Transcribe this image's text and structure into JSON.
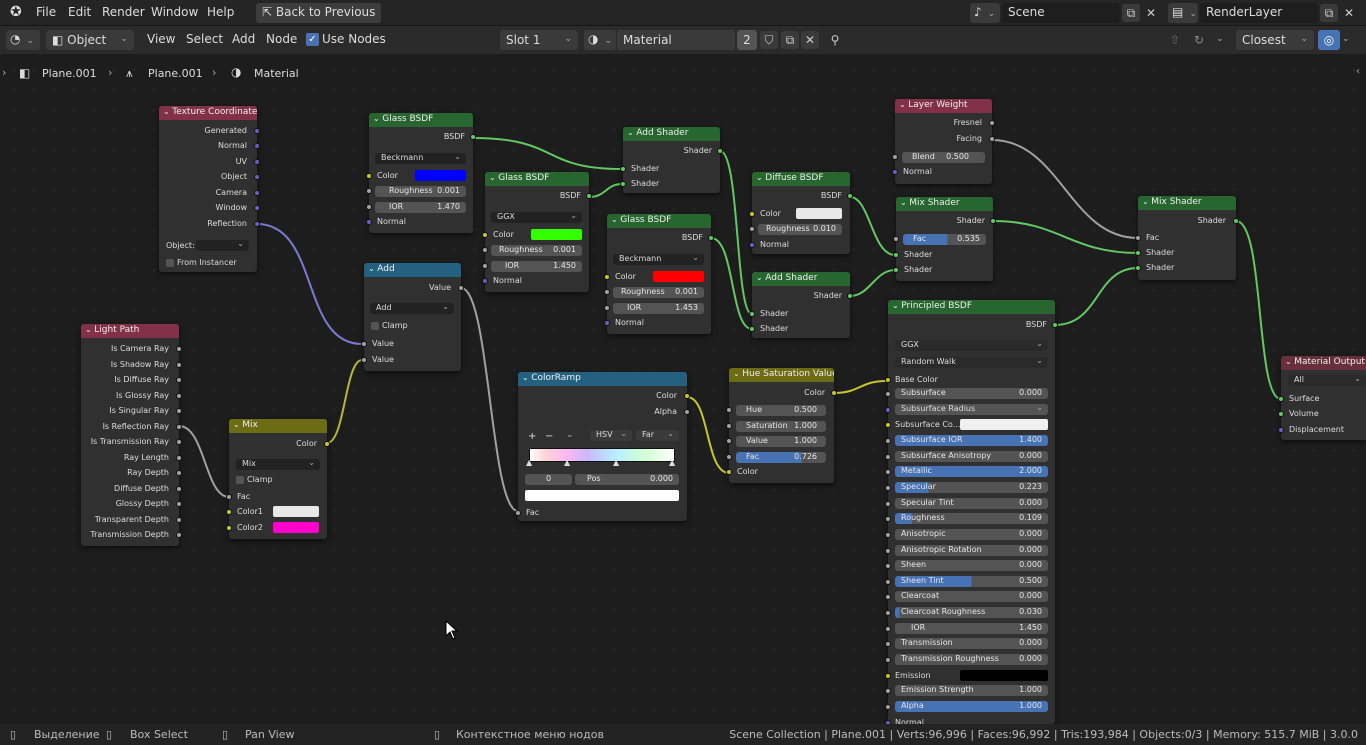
{
  "menu": {
    "file": "File",
    "edit": "Edit",
    "render": "Render",
    "window": "Window",
    "help": "Help",
    "back": "Back to Previous"
  },
  "scene": {
    "name": "Scene",
    "layer": "RenderLayer"
  },
  "header": {
    "mode": "Object",
    "view": "View",
    "select": "Select",
    "add": "Add",
    "node": "Node",
    "use_nodes": "Use Nodes",
    "slot": "Slot 1",
    "material": "Material",
    "users": "2",
    "snap": "Closest"
  },
  "breadcrumb": {
    "obj": "Plane.001",
    "mesh": "Plane.001",
    "mat": "Material"
  },
  "colors": {
    "accent": "#4772b3",
    "shader_header": "#27662f",
    "input_header": "#83314a",
    "converter_header": "#24607f",
    "color_header": "#6c6c14"
  },
  "nodes": {
    "texcoord": {
      "title": "Texture Coordinate",
      "outs": [
        "Generated",
        "Normal",
        "UV",
        "Object",
        "Camera",
        "Window",
        "Reflection"
      ],
      "object": "Object:",
      "from_instancer": "From Instancer"
    },
    "lightpath": {
      "title": "Light Path",
      "outs": [
        "Is Camera Ray",
        "Is Shadow Ray",
        "Is Diffuse Ray",
        "Is Glossy Ray",
        "Is Singular Ray",
        "Is Reflection Ray",
        "Is Transmission Ray",
        "Ray Length",
        "Ray Depth",
        "Diffuse Depth",
        "Glossy Depth",
        "Transparent Depth",
        "Transmission Depth"
      ]
    },
    "glass1": {
      "title": "Glass BSDF",
      "out": "BSDF",
      "dist": "Beckmann",
      "color": "Color",
      "rough_l": "Roughness",
      "rough": "0.001",
      "ior_l": "IOR",
      "ior": "1.470",
      "normal": "Normal"
    },
    "glass2": {
      "title": "Glass BSDF",
      "out": "BSDF",
      "dist": "GGX",
      "color": "Color",
      "rough_l": "Roughness",
      "rough": "0.001",
      "ior_l": "IOR",
      "ior": "1.450",
      "normal": "Normal"
    },
    "glass3": {
      "title": "Glass BSDF",
      "out": "BSDF",
      "dist": "Beckmann",
      "color": "Color",
      "rough_l": "Roughness",
      "rough": "0.001",
      "ior_l": "IOR",
      "ior": "1.453",
      "normal": "Normal"
    },
    "add": {
      "title": "Add",
      "out": "Value",
      "op": "Add",
      "clamp": "Clamp",
      "in1": "Value",
      "in2": "Value"
    },
    "mix": {
      "title": "Mix",
      "out": "Color",
      "blend": "Mix",
      "clamp": "Clamp",
      "fac": "Fac",
      "c1": "Color1",
      "c2": "Color2"
    },
    "addshader1": {
      "title": "Add Shader",
      "out": "Shader",
      "in1": "Shader",
      "in2": "Shader"
    },
    "addshader2": {
      "title": "Add Shader",
      "out": "Shader",
      "in1": "Shader",
      "in2": "Shader"
    },
    "diffuse": {
      "title": "Diffuse BSDF",
      "out": "BSDF",
      "color": "Color",
      "rough_l": "Roughness",
      "rough": "0.010",
      "normal": "Normal"
    },
    "layerweight": {
      "title": "Layer Weight",
      "fresnel": "Fresnel",
      "facing": "Facing",
      "blend_l": "Blend",
      "blend": "0.500",
      "normal": "Normal"
    },
    "mixshader1": {
      "title": "Mix Shader",
      "out": "Shader",
      "fac_l": "Fac",
      "fac": "0.535",
      "in1": "Shader",
      "in2": "Shader"
    },
    "mixshader2": {
      "title": "Mix Shader",
      "out": "Shader",
      "fac": "Fac",
      "in1": "Shader",
      "in2": "Shader"
    },
    "colorramp": {
      "title": "ColorRamp",
      "color": "Color",
      "alpha": "Alpha",
      "plus": "+",
      "minus": "−",
      "mode": "HSV",
      "interp": "Far",
      "index": "0",
      "pos_l": "Pos",
      "pos": "0.000",
      "fac": "Fac"
    },
    "hsv": {
      "title": "Hue Saturation Value",
      "out": "Color",
      "hue_l": "Hue",
      "hue": "0.500",
      "sat_l": "Saturation",
      "sat": "1.000",
      "val_l": "Value",
      "val": "1.000",
      "fac_l": "Fac",
      "fac": "0.726",
      "color": "Color"
    },
    "principled": {
      "title": "Principled BSDF",
      "out": "BSDF",
      "dist": "GGX",
      "sss": "Random Walk",
      "base": "Base Color",
      "fields": [
        [
          "Subsurface",
          "0.000"
        ],
        [
          "Subsurface Radius",
          ""
        ],
        [
          "Subsurface Co...",
          ""
        ],
        [
          "Subsurface IOR",
          "1.400"
        ],
        [
          "Subsurface Anisotropy",
          "0.000"
        ],
        [
          "Metallic",
          "2.000"
        ],
        [
          "Specular",
          "0.223"
        ],
        [
          "Specular Tint",
          "0.000"
        ],
        [
          "Roughness",
          "0.109"
        ],
        [
          "Anisotropic",
          "0.000"
        ],
        [
          "Anisotropic Rotation",
          "0.000"
        ],
        [
          "Sheen",
          "0.000"
        ],
        [
          "Sheen Tint",
          "0.500"
        ],
        [
          "Clearcoat",
          "0.000"
        ],
        [
          "Clearcoat Roughness",
          "0.030"
        ],
        [
          "IOR",
          "1.450"
        ],
        [
          "Transmission",
          "0.000"
        ],
        [
          "Transmission Roughness",
          "0.000"
        ],
        [
          "Emission",
          ""
        ],
        [
          "Emission Strength",
          "1.000"
        ],
        [
          "Alpha",
          "1.000"
        ],
        [
          "Normal",
          ""
        ]
      ]
    },
    "output": {
      "title": "Material Output",
      "target": "All",
      "surface": "Surface",
      "volume": "Volume",
      "disp": "Displacement"
    }
  },
  "status": {
    "select": "Выделение",
    "box": "Box Select",
    "pan": "Pan View",
    "ctx": "Контекстное меню нодов",
    "info": "Scene Collection | Plane.001 | Verts:96,996 | Faces:96,992 | Tris:193,984 | Objects:0/3 | Memory: 515.7 MiB | 3.0.0"
  }
}
